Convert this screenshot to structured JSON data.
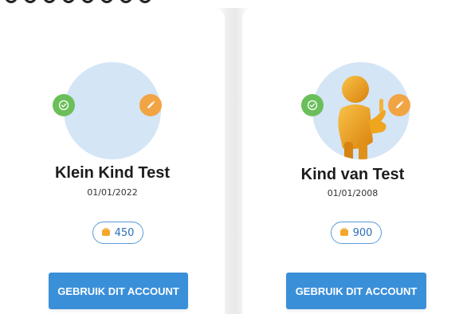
{
  "accounts": [
    {
      "name": "Klein Kind Test",
      "dob": "01/01/2022",
      "coins": "450",
      "button_label": "GEBRUIK DIT ACCOUNT",
      "avatar": "none"
    },
    {
      "name": "Kind van Test",
      "dob": "01/01/2008",
      "coins": "900",
      "button_label": "GEBRUIK DIT ACCOUNT",
      "avatar": "thumbs-up-figure"
    }
  ],
  "colors": {
    "avatar_bg": "#d4e5f6",
    "check_badge": "#6bbf5a",
    "edit_badge": "#f1a444",
    "primary_button": "#3a8fd9",
    "coin": "#f3a72e",
    "pill_border": "#5a9ad8"
  },
  "icons": {
    "check": "check-icon",
    "edit": "pencil-icon",
    "coin": "coin-icon"
  }
}
